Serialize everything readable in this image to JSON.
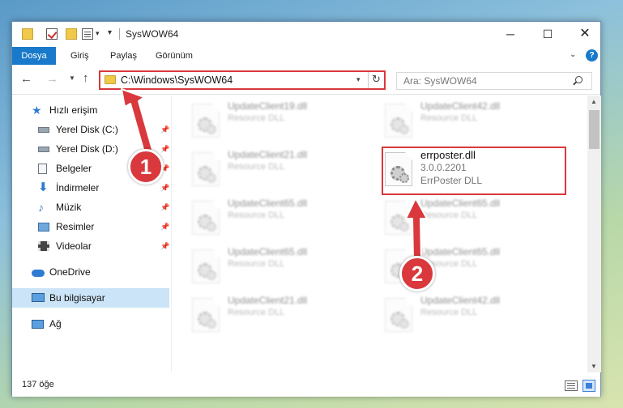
{
  "window": {
    "title": "SysWOW64",
    "qa_dropdown": "▾",
    "qa_customize": "▾"
  },
  "ribbon": {
    "tabs": [
      "Dosya",
      "Giriş",
      "Paylaş",
      "Görünüm"
    ]
  },
  "nav": {
    "address": "C:\\Windows\\SysWOW64",
    "search_placeholder": "Ara: SysWOW64"
  },
  "sidebar": {
    "items": [
      {
        "label": "Hızlı erişim",
        "icon": "star-icon"
      },
      {
        "label": "Yerel Disk (C:)",
        "icon": "drive-icon"
      },
      {
        "label": "Yerel Disk (D:)",
        "icon": "drive-icon"
      },
      {
        "label": "Belgeler",
        "icon": "documents-icon"
      },
      {
        "label": "İndirmeler",
        "icon": "download-icon"
      },
      {
        "label": "Müzik",
        "icon": "music-icon"
      },
      {
        "label": "Resimler",
        "icon": "pictures-icon"
      },
      {
        "label": "Videolar",
        "icon": "video-icon"
      },
      {
        "label": "OneDrive",
        "icon": "cloud-icon"
      },
      {
        "label": "Bu bilgisayar",
        "icon": "computer-icon"
      },
      {
        "label": "Ağ",
        "icon": "network-icon"
      }
    ]
  },
  "files": [
    {
      "name": "UpdateClient19.dll",
      "type": "Resource DLL"
    },
    {
      "name": "UpdateClient42.dll",
      "type": "Resource DLL"
    },
    {
      "name": "UpdateClient21.dll",
      "type": "Resource DLL"
    },
    {
      "name": "errposter.dll",
      "version": "3.0.0.2201",
      "type": "ErrPoster DLL"
    },
    {
      "name": "UpdateClient65.dll",
      "type": "Resource DLL"
    },
    {
      "name": "UpdateClient65.dll",
      "type": "Resource DLL"
    },
    {
      "name": "UpdateClient65.dll",
      "type": "Resource DLL"
    },
    {
      "name": "UpdateClient65.dll",
      "type": "Resource DLL"
    },
    {
      "name": "UpdateClient21.dll",
      "type": "Resource DLL"
    },
    {
      "name": "UpdateClient42.dll",
      "type": "Resource DLL"
    }
  ],
  "status": {
    "item_count": "137 öğe"
  },
  "annotations": {
    "step1": "1",
    "step2": "2",
    "color": "#d9383c"
  }
}
